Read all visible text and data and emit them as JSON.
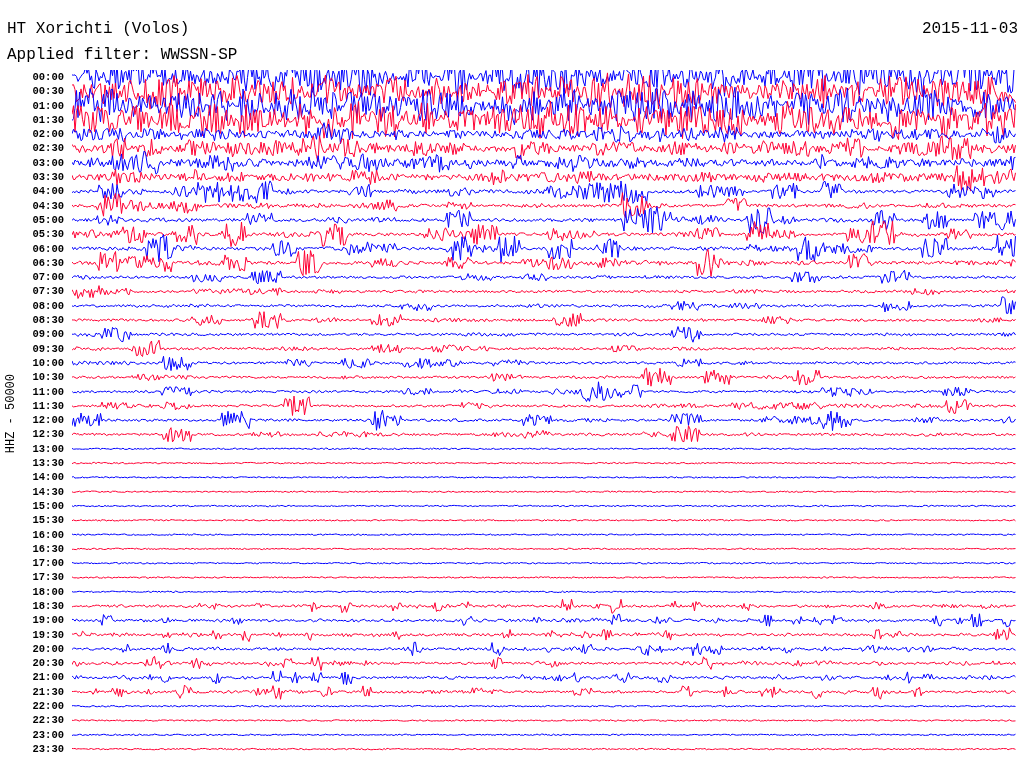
{
  "title": "HT Xorichti (Volos)",
  "date": "2015-11-03",
  "filter": "Applied filter: WWSSN-SP",
  "channel_label": "HHZ - 50000",
  "rows": [
    {
      "time": "00:00",
      "color": "#0000ff"
    },
    {
      "time": "00:30",
      "color": "#ff0033"
    },
    {
      "time": "01:00",
      "color": "#0000ff"
    },
    {
      "time": "01:30",
      "color": "#ff0033"
    },
    {
      "time": "02:00",
      "color": "#0000ff"
    },
    {
      "time": "02:30",
      "color": "#ff0033"
    },
    {
      "time": "03:00",
      "color": "#0000ff"
    },
    {
      "time": "03:30",
      "color": "#ff0033"
    },
    {
      "time": "04:00",
      "color": "#0000ff"
    },
    {
      "time": "04:30",
      "color": "#ff0033"
    },
    {
      "time": "05:00",
      "color": "#0000ff"
    },
    {
      "time": "05:30",
      "color": "#ff0033"
    },
    {
      "time": "06:00",
      "color": "#0000ff"
    },
    {
      "time": "06:30",
      "color": "#ff0033"
    },
    {
      "time": "07:00",
      "color": "#0000ff"
    },
    {
      "time": "07:30",
      "color": "#ff0033"
    },
    {
      "time": "08:00",
      "color": "#0000ff"
    },
    {
      "time": "08:30",
      "color": "#ff0033"
    },
    {
      "time": "09:00",
      "color": "#0000ff"
    },
    {
      "time": "09:30",
      "color": "#ff0033"
    },
    {
      "time": "10:00",
      "color": "#0000ff"
    },
    {
      "time": "10:30",
      "color": "#ff0033"
    },
    {
      "time": "11:00",
      "color": "#0000ff"
    },
    {
      "time": "11:30",
      "color": "#ff0033"
    },
    {
      "time": "12:00",
      "color": "#0000ff"
    },
    {
      "time": "12:30",
      "color": "#ff0033"
    },
    {
      "time": "13:00",
      "color": "#0000ff"
    },
    {
      "time": "13:30",
      "color": "#ff0033"
    },
    {
      "time": "14:00",
      "color": "#0000ff"
    },
    {
      "time": "14:30",
      "color": "#ff0033"
    },
    {
      "time": "15:00",
      "color": "#0000ff"
    },
    {
      "time": "15:30",
      "color": "#ff0033"
    },
    {
      "time": "16:00",
      "color": "#0000ff"
    },
    {
      "time": "16:30",
      "color": "#ff0033"
    },
    {
      "time": "17:00",
      "color": "#0000ff"
    },
    {
      "time": "17:30",
      "color": "#ff0033"
    },
    {
      "time": "18:00",
      "color": "#0000ff"
    },
    {
      "time": "18:30",
      "color": "#ff0033"
    },
    {
      "time": "19:00",
      "color": "#0000ff"
    },
    {
      "time": "19:30",
      "color": "#ff0033"
    },
    {
      "time": "20:00",
      "color": "#0000ff"
    },
    {
      "time": "20:30",
      "color": "#ff0033"
    },
    {
      "time": "21:00",
      "color": "#0000ff"
    },
    {
      "time": "21:30",
      "color": "#ff0033"
    },
    {
      "time": "22:00",
      "color": "#0000ff"
    },
    {
      "time": "22:30",
      "color": "#ff0033"
    },
    {
      "time": "23:00",
      "color": "#0000ff"
    },
    {
      "time": "23:30",
      "color": "#ff0033"
    }
  ]
}
